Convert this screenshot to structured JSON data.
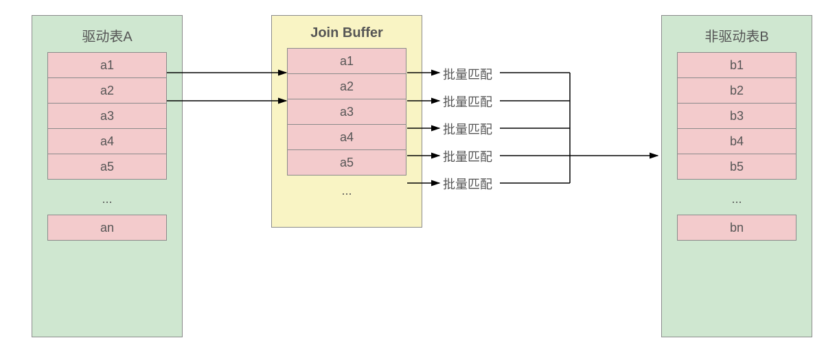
{
  "tableA": {
    "title": "驱动表A",
    "rows": [
      "a1",
      "a2",
      "a3",
      "a4",
      "a5"
    ],
    "ellipsis": "...",
    "last": "an"
  },
  "buffer": {
    "title": "Join Buffer",
    "rows": [
      "a1",
      "a2",
      "a3",
      "a4",
      "a5"
    ],
    "ellipsis": "..."
  },
  "tableB": {
    "title": "非驱动表B",
    "rows": [
      "b1",
      "b2",
      "b3",
      "b4",
      "b5"
    ],
    "ellipsis": "...",
    "last": "bn"
  },
  "match_labels": [
    "批量匹配",
    "批量匹配",
    "批量匹配",
    "批量匹配",
    "批量匹配"
  ]
}
